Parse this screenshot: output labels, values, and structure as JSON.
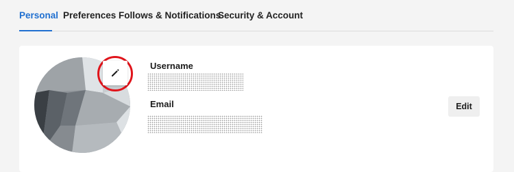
{
  "tabs": [
    {
      "label": "Personal",
      "active": true
    },
    {
      "label": "Preferences",
      "active": false
    },
    {
      "label": "Follows & Notifications",
      "active": false
    },
    {
      "label": "Security & Account",
      "active": false
    }
  ],
  "profile": {
    "username_label": "Username",
    "email_label": "Email",
    "edit_label": "Edit",
    "edit_avatar_icon": "pencil-icon"
  },
  "colors": {
    "accent": "#1f6fd0",
    "highlight": "#e0141b"
  }
}
